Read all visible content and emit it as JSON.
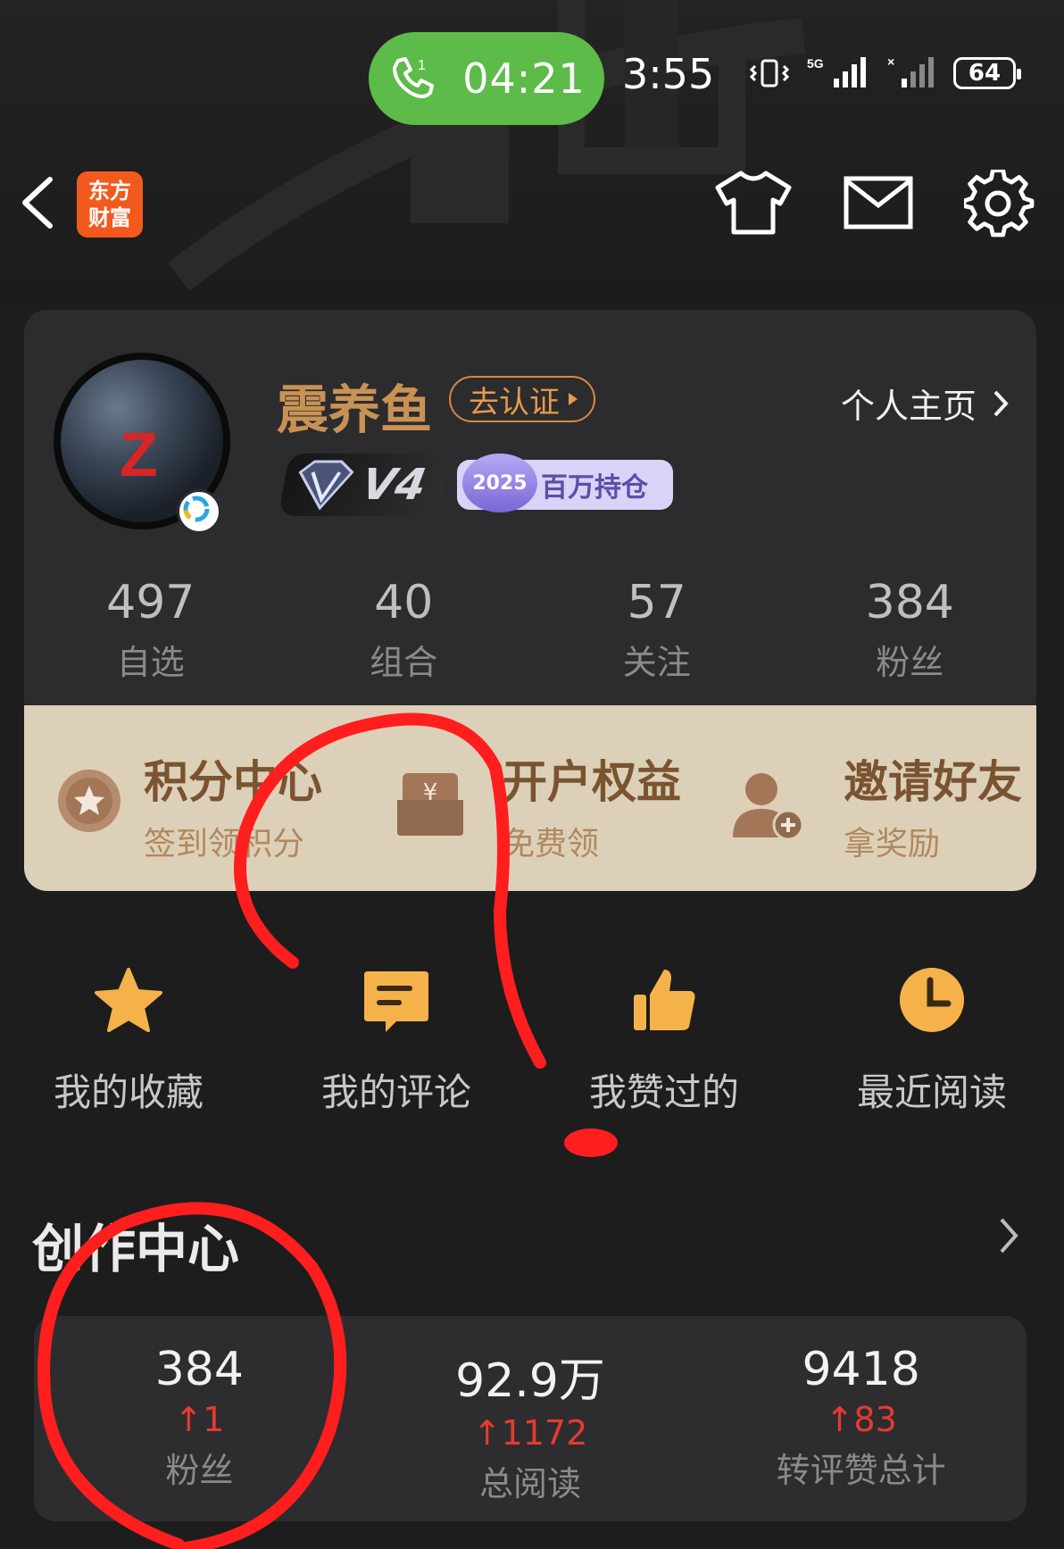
{
  "status_bar": {
    "call_timer": "04:21",
    "clock": "3:55",
    "network": "5G",
    "battery": "64"
  },
  "nav": {
    "app_logo_line1": "东方",
    "app_logo_line2": "财富",
    "icons": [
      "back-icon",
      "shirt-icon",
      "mail-icon",
      "gear-icon"
    ]
  },
  "profile": {
    "avatar_letter": "Z",
    "username": "震养鱼",
    "verify_label": "去认证",
    "homepage_label": "个人主页",
    "vip_level": "V4",
    "holder_year": "2025",
    "holder_label": "百万持仓",
    "stats": [
      {
        "value": "497",
        "label": "自选"
      },
      {
        "value": "40",
        "label": "组合"
      },
      {
        "value": "57",
        "label": "关注"
      },
      {
        "value": "384",
        "label": "粉丝"
      }
    ]
  },
  "benefits": [
    {
      "title": "积分中心",
      "subtitle": "签到领积分"
    },
    {
      "title": "开户权益",
      "subtitle": "免费领"
    },
    {
      "title": "邀请好友",
      "subtitle": "拿奖励"
    }
  ],
  "actions": [
    {
      "label": "我的收藏",
      "icon": "star-icon"
    },
    {
      "label": "我的评论",
      "icon": "comment-icon"
    },
    {
      "label": "我赞过的",
      "icon": "thumbs-up-icon"
    },
    {
      "label": "最近阅读",
      "icon": "clock-icon"
    }
  ],
  "creator": {
    "title": "创作中心",
    "stats": [
      {
        "value": "384",
        "delta": "↑1",
        "label": "粉丝"
      },
      {
        "value": "92.9万",
        "delta": "↑1172",
        "label": "总阅读"
      },
      {
        "value": "9418",
        "delta": "↑83",
        "label": "转评赞总计"
      }
    ]
  },
  "colors": {
    "background": "#1d1d1e",
    "card": "#2c2c2e",
    "accent_orange": "#e59a4c",
    "call_green": "#5dbb4a",
    "benefit_bg": "#ddd0b8",
    "delta_red": "#e43b30",
    "annotation_red": "#ff1e1e"
  }
}
